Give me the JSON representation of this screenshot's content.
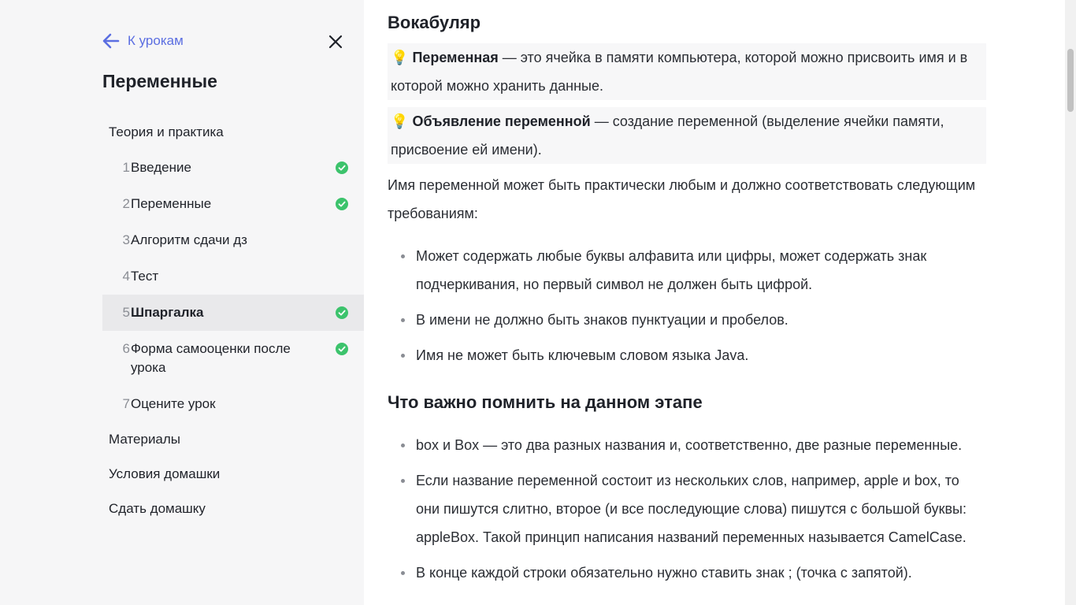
{
  "sidebar": {
    "back_label": "К урокам",
    "lesson_title": "Переменные",
    "sections": [
      {
        "label": "Теория и практика"
      },
      {
        "label": "Материалы"
      },
      {
        "label": "Условия домашки"
      },
      {
        "label": "Сдать домашку"
      }
    ],
    "items": [
      {
        "num": "1",
        "label": "Введение",
        "status": "done"
      },
      {
        "num": "2",
        "label": "Переменные",
        "status": "done"
      },
      {
        "num": "3",
        "label": "Алгоритм сдачи дз",
        "status": "todo"
      },
      {
        "num": "4",
        "label": "Тест",
        "status": "todo"
      },
      {
        "num": "5",
        "label": "Шпаргалка",
        "status": "done",
        "active": true
      },
      {
        "num": "6",
        "label": "Форма самооценки после урока",
        "status": "done"
      },
      {
        "num": "7",
        "label": "Оцените урок",
        "status": "none"
      }
    ]
  },
  "content": {
    "vocab_heading": "Вокабуляр",
    "callouts": [
      {
        "icon": "💡",
        "term": "Переменная",
        "text": " — это ячейка в памяти компьютера, которой можно присвоить имя и в которой можно хранить данные."
      },
      {
        "icon": "💡",
        "term": "Объявление переменной",
        "text": " — создание переменной (выделение ячейки  памяти, присвоение ей имени)."
      }
    ],
    "intro": "Имя переменной может быть практически любым и должно соответствовать следующим требованиям:",
    "rules": [
      "Может содержать любые буквы алфавита или цифры, может содержать знак подчеркивания, но первый символ не должен быть цифрой.",
      "В имени не должно быть знаков пунктуации и пробелов.",
      "Имя не может быть ключевым словом языка Java."
    ],
    "remember_heading": "Что важно помнить на данном этапе",
    "remember": [
      "box и Box — это два разных названия и, соответственно, две разные переменные.",
      "Если название переменной состоит из нескольких слов, например, apple и box, то они пишутся слитно, второе (и все последующие слова) пишутся с большой буквы: appleBox. Такой принцип написания названий переменных называется CamelCase.",
      "В конце каждой строки обязательно нужно ставить знак ; (точка с запятой)."
    ]
  },
  "colors": {
    "accent": "#5b6ee1",
    "done": "#3cc36c",
    "todo": "#dcdde0",
    "sidebar_bg": "#f6f6f7",
    "active_bg": "#e9e9eb"
  }
}
